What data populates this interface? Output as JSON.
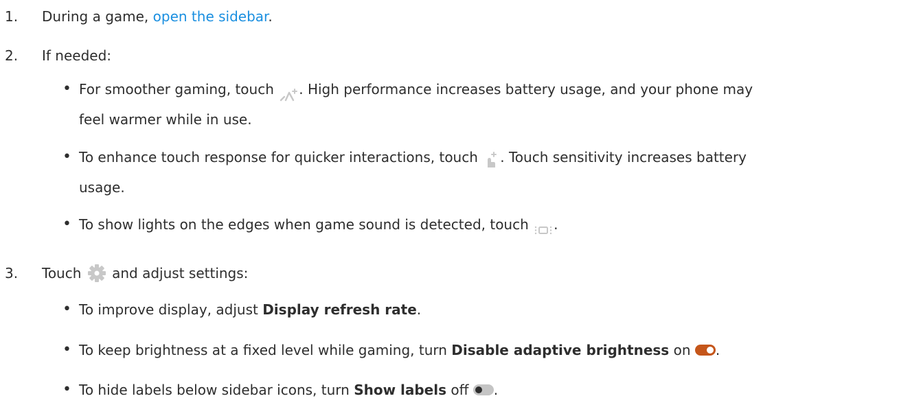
{
  "steps": [
    {
      "number": "1.",
      "text_before": "During a game, ",
      "link_text": "open the sidebar",
      "text_after": "."
    },
    {
      "number": "2.",
      "text": "If needed:",
      "bullets": [
        {
          "before": "For smoother gaming, touch ",
          "icon": "high-performance-icon",
          "after_line1": ". High performance increases battery usage, and your phone may",
          "line2": "feel warmer while in use."
        },
        {
          "before": "To enhance touch response for quicker interactions, touch ",
          "icon": "touch-sensitivity-icon",
          "after_line1": ". Touch sensitivity increases battery",
          "line2": "usage."
        },
        {
          "before": "To show lights on the edges when game sound is detected, touch ",
          "icon": "edge-lights-icon",
          "after": "."
        }
      ]
    },
    {
      "number": "3.",
      "text_before": "Touch ",
      "icon": "gear-icon",
      "text_after": " and adjust settings:",
      "bullets": [
        {
          "before": "To improve display, adjust ",
          "bold": "Display refresh rate",
          "after": "."
        },
        {
          "before": "To keep brightness at a fixed level while gaming, turn ",
          "bold": "Disable adaptive brightness",
          "middle": " on ",
          "toggle_state": "on",
          "after": "."
        },
        {
          "before": "To hide labels below sidebar icons, turn ",
          "bold": "Show labels",
          "middle": " off ",
          "toggle_state": "off",
          "after": "."
        }
      ]
    }
  ],
  "colors": {
    "text": "#2e2e2e",
    "link": "#1a8fe0",
    "toggle_on": "#c5561a",
    "toggle_off": "#c4c4c4",
    "icon_gray": "#c8c8c8"
  }
}
